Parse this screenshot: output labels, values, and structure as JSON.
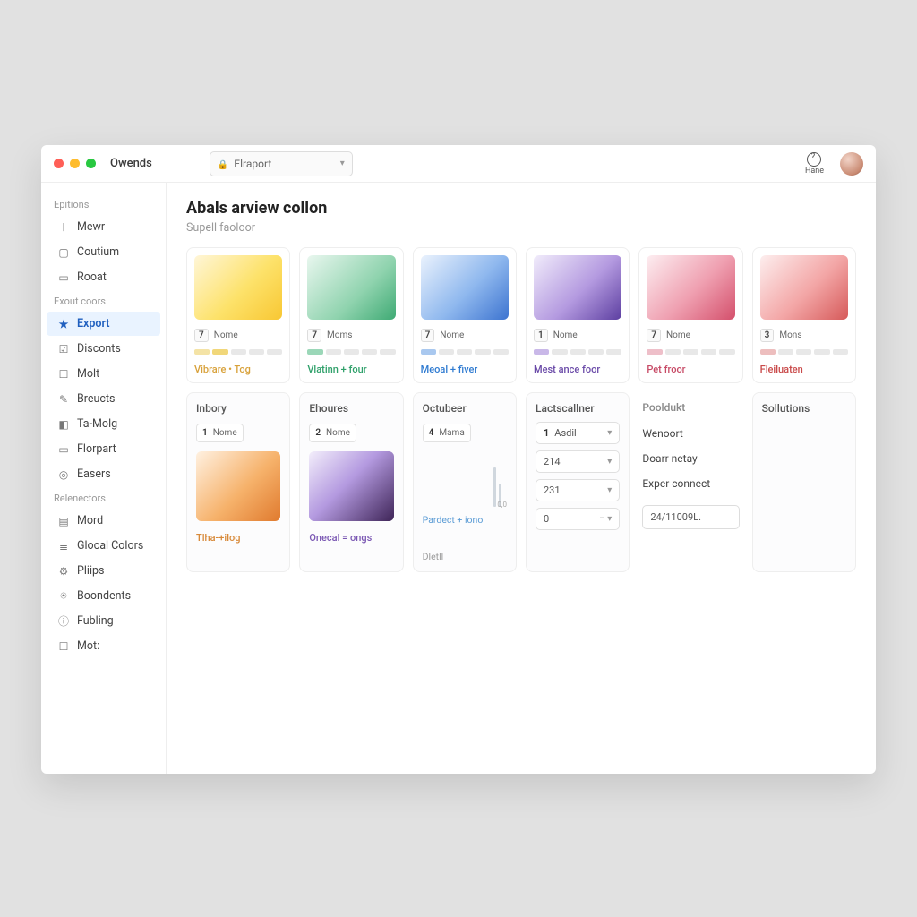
{
  "window": {
    "title": "Owends"
  },
  "header": {
    "dropdown_label": "Elraport",
    "hane_label": "Hane"
  },
  "sidebar": {
    "groups": [
      {
        "label": "Epitions",
        "items": [
          {
            "icon": "i-plus",
            "label": "Mewr"
          },
          {
            "icon": "i-square",
            "label": "Coutium"
          },
          {
            "icon": "i-book",
            "label": "Rooat"
          }
        ]
      },
      {
        "label": "Exout coors",
        "items": [
          {
            "icon": "i-star",
            "label": "Export",
            "active": true
          },
          {
            "icon": "i-check",
            "label": "Disconts"
          },
          {
            "icon": "i-inbox",
            "label": "Molt"
          },
          {
            "icon": "i-pen",
            "label": "Breucts"
          },
          {
            "icon": "i-tag",
            "label": "Ta-Molg"
          },
          {
            "icon": "i-screen",
            "label": "Florpart"
          },
          {
            "icon": "i-target",
            "label": "Easers"
          }
        ]
      },
      {
        "label": "Relenectors",
        "items": [
          {
            "icon": "i-bars",
            "label": "Mord"
          },
          {
            "icon": "i-stack",
            "label": "Glocal Colors"
          },
          {
            "icon": "i-gear",
            "label": "Pliips"
          },
          {
            "icon": "i-user",
            "label": "Boondents"
          },
          {
            "icon": "i-info",
            "label": "Fubling"
          },
          {
            "icon": "i-out",
            "label": "Mot:"
          }
        ]
      }
    ]
  },
  "page": {
    "title": "Abals arview collon",
    "subtitle": "Supell faoloor"
  },
  "cards": [
    {
      "count": "7",
      "name": "Nome",
      "footer": "Vibrare • Tog",
      "footer_color": "#d8a13a",
      "gradient": "linear-gradient(135deg,#fff6d8 0%,#fde26a 55%,#f8c733 100%)",
      "meter": [
        "#f4e3a6",
        "#f1d77a",
        "#e8e8e8",
        "#e8e8e8",
        "#e8e8e8"
      ]
    },
    {
      "count": "7",
      "name": "Moms",
      "footer": "Vlatinn + four",
      "footer_color": "#2fa06a",
      "gradient": "linear-gradient(135deg,#e9f7ef 0%,#8fd3ae 60%,#3faa74 100%)",
      "meter": [
        "#9bd7b8",
        "#e8e8e8",
        "#e8e8e8",
        "#e8e8e8",
        "#e8e8e8"
      ]
    },
    {
      "count": "7",
      "name": "Nome",
      "footer": "Meoal + fiver",
      "footer_color": "#2f7bd1",
      "gradient": "linear-gradient(135deg,#eaf2fd 0%,#8fb8ee 55%,#3d74d0 100%)",
      "meter": [
        "#a9c8ef",
        "#e8e8e8",
        "#e8e8e8",
        "#e8e8e8",
        "#e8e8e8"
      ]
    },
    {
      "count": "1",
      "name": "Nome",
      "footer": "Mest ance foor",
      "footer_color": "#6a4aa8",
      "gradient": "linear-gradient(135deg,#f1ecfb 0%,#b49ae0 55%,#5d3fa1 100%)",
      "meter": [
        "#c9b8e8",
        "#e8e8e8",
        "#e8e8e8",
        "#e8e8e8",
        "#e8e8e8"
      ]
    },
    {
      "count": "7",
      "name": "Nome",
      "footer": "Pet froor",
      "footer_color": "#c74a66",
      "gradient": "linear-gradient(135deg,#fdeef1 0%,#ef9fb0 55%,#d4506c 100%)",
      "meter": [
        "#eebfc9",
        "#e8e8e8",
        "#e8e8e8",
        "#e8e8e8",
        "#e8e8e8"
      ]
    },
    {
      "count": "3",
      "name": "Mons",
      "footer": "Fleiluaten",
      "footer_color": "#c94a4a",
      "gradient": "linear-gradient(135deg,#fdeeee 0%,#f3a6a6 55%,#d65a5a 100%)",
      "meter": [
        "#edbebe",
        "#e8e8e8",
        "#e8e8e8",
        "#e8e8e8",
        "#e8e8e8"
      ]
    }
  ],
  "panels": {
    "p1": {
      "title": "Inbory",
      "count": "1",
      "name": "Nome",
      "gradient": "linear-gradient(135deg,#fff1e1 0%,#f6b26b 55%,#e07a2e 100%)",
      "footer": "Tlha-+ilog",
      "footer_color": "#d88a3a"
    },
    "p2": {
      "title": "Ehoures",
      "count": "2",
      "name": "Nome",
      "gradient": "linear-gradient(135deg,#f3eefb 0%,#b49ae0 45%,#3e2457 100%)",
      "footer": "Onecal = ongs",
      "footer_color": "#7a57b3"
    },
    "p3": {
      "title": "Octubeer",
      "count": "4",
      "name": "Mama",
      "line1": "Pardect + iono",
      "sub": "Dletll"
    },
    "p4": {
      "title": "Lactscallner",
      "rows": [
        {
          "n": "1",
          "label": "Asdil"
        },
        {
          "n": "",
          "label": "214"
        },
        {
          "n": "",
          "label": "231"
        },
        {
          "n": "",
          "label": "0",
          "dash": true
        }
      ]
    },
    "p5": {
      "title": "Pooldukt",
      "links": [
        "Wenoort",
        "Doarr netay",
        "Exper connect"
      ],
      "input": "24/11009L."
    },
    "p6": {
      "title": "Sollutions"
    }
  }
}
